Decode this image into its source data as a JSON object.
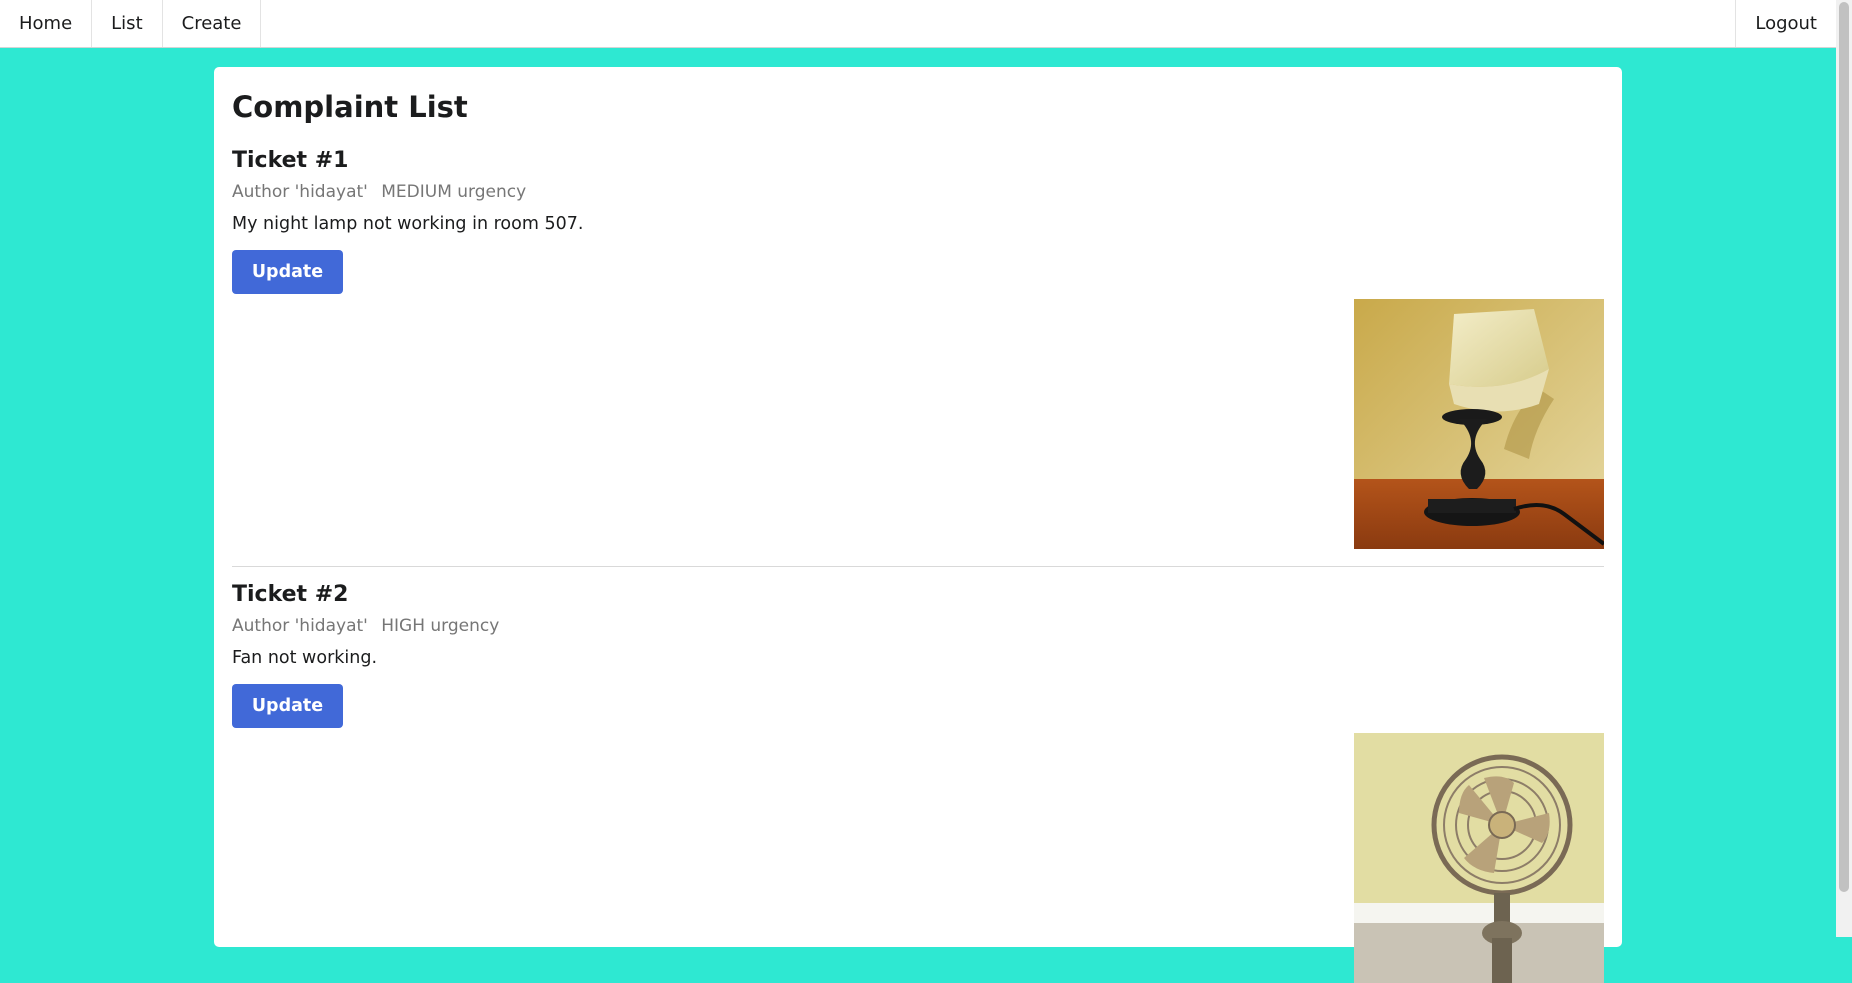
{
  "nav": {
    "home": "Home",
    "list": "List",
    "create": "Create",
    "logout": "Logout"
  },
  "page": {
    "title": "Complaint List"
  },
  "tickets": [
    {
      "title": "Ticket #1",
      "author": "Author 'hidayat'",
      "urgency": "MEDIUM urgency",
      "description": "My night lamp not working in room 507.",
      "button": "Update",
      "image": "night-lamp-photo"
    },
    {
      "title": "Ticket #2",
      "author": "Author 'hidayat'",
      "urgency": "HIGH urgency",
      "description": "Fan not working.",
      "button": "Update",
      "image": "desk-fan-photo"
    }
  ],
  "colors": {
    "background": "#2ee8d2",
    "button": "#4169d8"
  }
}
